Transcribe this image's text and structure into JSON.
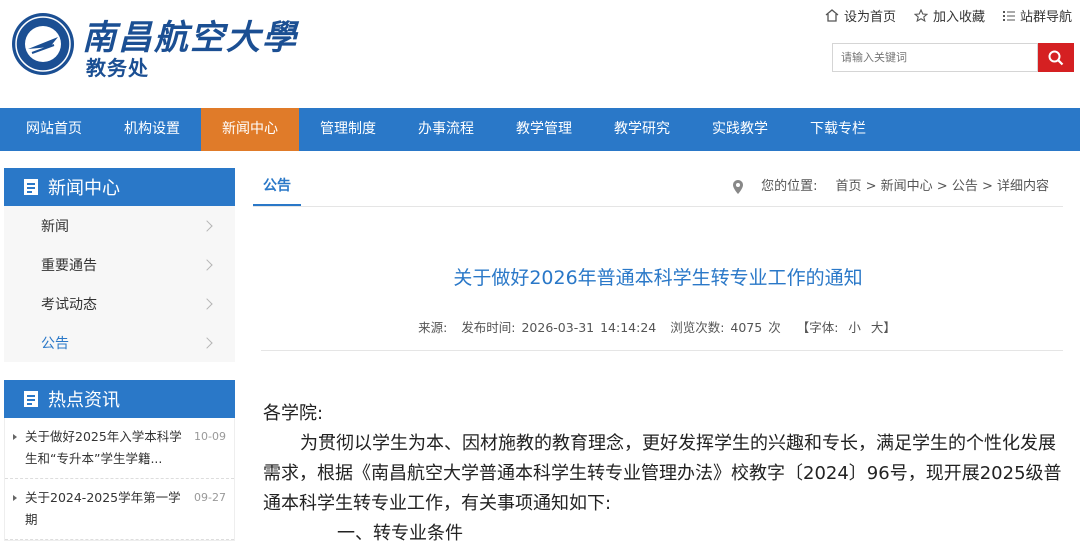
{
  "header": {
    "school_name": "南昌航空大學",
    "dept_name": "教务处",
    "top_links": {
      "homepage": "设为首页",
      "favorite": "加入收藏",
      "site_nav": "站群导航"
    },
    "search_placeholder": "请输入关键词"
  },
  "nav": {
    "items": [
      "网站首页",
      "机构设置",
      "新闻中心",
      "管理制度",
      "办事流程",
      "教学管理",
      "教学研究",
      "实践教学",
      "下载专栏"
    ],
    "active": "新闻中心"
  },
  "sidebar": {
    "news_title": "新闻中心",
    "news_items": [
      "新闻",
      "重要通告",
      "考试动态",
      "公告"
    ],
    "active": "公告",
    "hot_title": "热点资讯",
    "hot_items": [
      {
        "text": "关于做好2025年入学本科学生和“专升本”学生学籍...",
        "date": "10-09"
      },
      {
        "text": "关于2024-2025学年第一学期",
        "date": "09-27"
      }
    ]
  },
  "main": {
    "tab": "公告",
    "breadcrumb": {
      "label": "您的位置:",
      "path": "首页 > 新闻中心 > 公告 > 详细内容"
    },
    "title": "关于做好2026年普通本科学生转专业工作的通知",
    "meta": {
      "source_label": "来源:",
      "publish_time": "发布时间: 2026-03-31 14:14:24",
      "views": "浏览次数: 4075 次",
      "font_label": "【字体:",
      "font_small": "小",
      "font_large": "大】"
    },
    "salutation": "各学院:",
    "paragraph": "为贯彻以学生为本、因材施教的教育理念，更好发挥学生的兴趣和专长，满足学生的个性化发展需求，根据《南昌航空大学普通本科学生转专业管理办法》校教字〔2024〕96号，现开展2025级普通本科学生转专业工作，有关事项通知如下:",
    "cut_line": "一、转专业条件"
  },
  "colors": {
    "primary_blue": "#2a78c8",
    "active_orange": "#e07b29",
    "search_red": "#d52022"
  }
}
